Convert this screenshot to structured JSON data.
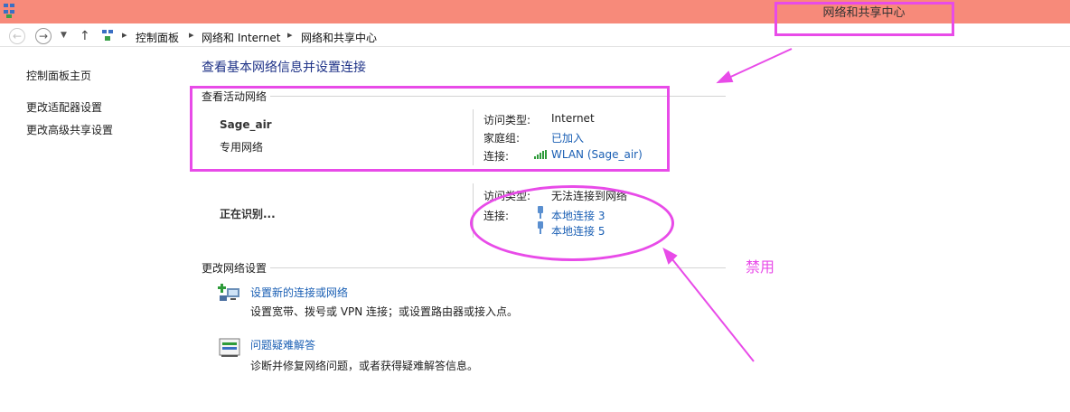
{
  "window": {
    "title": "网络和共享中心"
  },
  "address_bar": {
    "breadcrumbs": [
      "控制面板",
      "网络和 Internet",
      "网络和共享中心"
    ]
  },
  "sidebar": {
    "items": [
      {
        "label": "控制面板主页"
      },
      {
        "label": "更改适配器设置"
      },
      {
        "label": "更改高级共享设置"
      }
    ]
  },
  "main": {
    "title": "查看基本网络信息并设置连接",
    "active_networks_label": "查看活动网络",
    "networks": [
      {
        "name": "Sage_air",
        "type": "专用网络",
        "access_type_label": "访问类型:",
        "access_type": "Internet",
        "homegroup_label": "家庭组:",
        "homegroup": "已加入",
        "connection_label": "连接:",
        "connection": "WLAN (Sage_air)"
      },
      {
        "name": "正在识别...",
        "access_type_label": "访问类型:",
        "access_type": "无法连接到网络",
        "connection_label": "连接:",
        "connections": [
          "本地连接 3",
          "本地连接 5"
        ]
      }
    ],
    "change_settings_label": "更改网络设置",
    "tasks": [
      {
        "title": "设置新的连接或网络",
        "description": "设置宽带、拨号或 VPN 连接；或设置路由器或接入点。",
        "icon": "new-connection-icon"
      },
      {
        "title": "问题疑难解答",
        "description": "诊断并修复网络问题，或者获得疑难解答信息。",
        "icon": "troubleshoot-icon"
      }
    ]
  },
  "annotation": {
    "note": "禁用",
    "color": "#e84be8"
  }
}
